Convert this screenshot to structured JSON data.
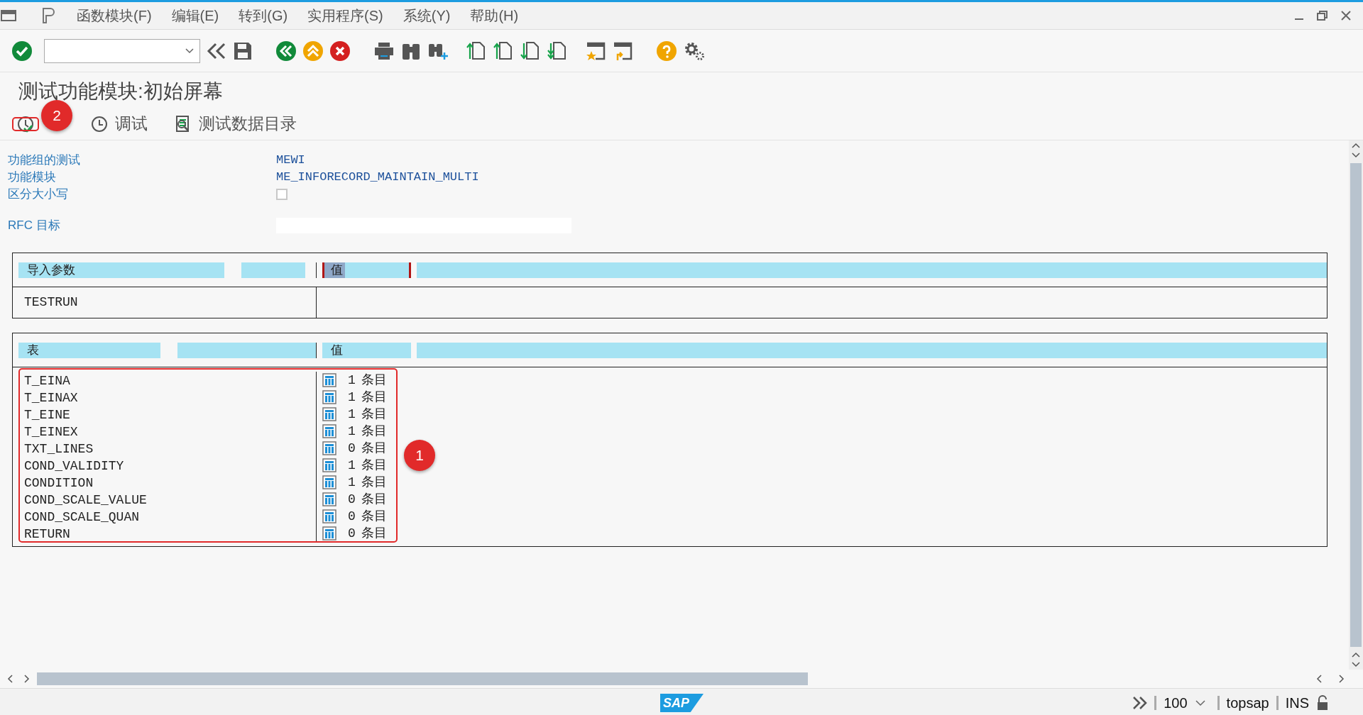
{
  "menu": [
    {
      "label": "函数模块(F)"
    },
    {
      "label": "编辑(E)"
    },
    {
      "label": "转到(G)"
    },
    {
      "label": "实用程序(S)"
    },
    {
      "label": "系统(Y)"
    },
    {
      "label": "帮助(H)"
    }
  ],
  "title": "测试功能模块:初始屏幕",
  "app_toolbar": [
    {
      "kind": "execute"
    },
    {
      "kind": "debug",
      "label": "调试"
    },
    {
      "kind": "data",
      "label": "测试数据目录"
    }
  ],
  "fields": [
    {
      "kind": "text",
      "label": "功能组的测试",
      "value": "MEWI"
    },
    {
      "kind": "text",
      "label": "功能模块",
      "value": "ME_INFORECORD_MAINTAIN_MULTI"
    },
    {
      "kind": "checkbox",
      "label": "区分大小写",
      "checked": false
    },
    {
      "kind": "input",
      "label": "RFC 目标"
    }
  ],
  "import_params": {
    "headers": [
      {
        "label": "导入参数",
        "focused": false
      },
      {
        "label": "值",
        "focused": true
      }
    ],
    "rows": [
      {
        "name": "TESTRUN"
      }
    ]
  },
  "tables": {
    "headers": [
      {
        "label": "表",
        "focused": false
      },
      {
        "label": "值",
        "focused": false
      }
    ],
    "rows": [
      {
        "name": "T_EINA",
        "count": "1",
        "unit": "条目"
      },
      {
        "name": "T_EINAX",
        "count": "1",
        "unit": "条目"
      },
      {
        "name": "T_EINE",
        "count": "1",
        "unit": "条目"
      },
      {
        "name": "T_EINEX",
        "count": "1",
        "unit": "条目"
      },
      {
        "name": "TXT_LINES",
        "count": "0",
        "unit": "条目"
      },
      {
        "name": "COND_VALIDITY",
        "count": "1",
        "unit": "条目"
      },
      {
        "name": "CONDITION",
        "count": "1",
        "unit": "条目"
      },
      {
        "name": "COND_SCALE_VALUE",
        "count": "0",
        "unit": "条目"
      },
      {
        "name": "COND_SCALE_QUAN",
        "count": "0",
        "unit": "条目"
      },
      {
        "name": "RETURN",
        "count": "0",
        "unit": "条目"
      }
    ]
  },
  "annotations": [
    {
      "label": "2"
    },
    {
      "label": "1"
    }
  ],
  "status_bar": {
    "logo": "SAP",
    "zoom": "100",
    "user": "topsap",
    "mode": "INS"
  }
}
